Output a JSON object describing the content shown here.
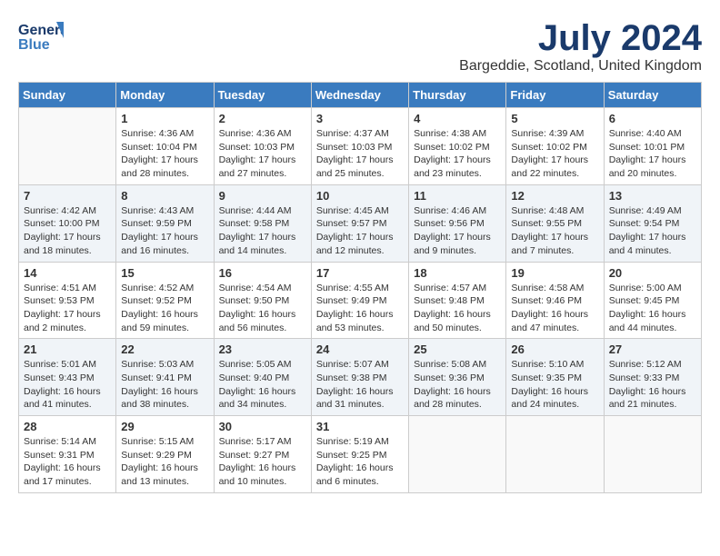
{
  "logo": {
    "line1": "General",
    "line2": "Blue"
  },
  "title": "July 2024",
  "location": "Bargeddie, Scotland, United Kingdom",
  "days_header": [
    "Sunday",
    "Monday",
    "Tuesday",
    "Wednesday",
    "Thursday",
    "Friday",
    "Saturday"
  ],
  "weeks": [
    [
      {
        "day": "",
        "info": ""
      },
      {
        "day": "1",
        "info": "Sunrise: 4:36 AM\nSunset: 10:04 PM\nDaylight: 17 hours\nand 28 minutes."
      },
      {
        "day": "2",
        "info": "Sunrise: 4:36 AM\nSunset: 10:03 PM\nDaylight: 17 hours\nand 27 minutes."
      },
      {
        "day": "3",
        "info": "Sunrise: 4:37 AM\nSunset: 10:03 PM\nDaylight: 17 hours\nand 25 minutes."
      },
      {
        "day": "4",
        "info": "Sunrise: 4:38 AM\nSunset: 10:02 PM\nDaylight: 17 hours\nand 23 minutes."
      },
      {
        "day": "5",
        "info": "Sunrise: 4:39 AM\nSunset: 10:02 PM\nDaylight: 17 hours\nand 22 minutes."
      },
      {
        "day": "6",
        "info": "Sunrise: 4:40 AM\nSunset: 10:01 PM\nDaylight: 17 hours\nand 20 minutes."
      }
    ],
    [
      {
        "day": "7",
        "info": "Sunrise: 4:42 AM\nSunset: 10:00 PM\nDaylight: 17 hours\nand 18 minutes."
      },
      {
        "day": "8",
        "info": "Sunrise: 4:43 AM\nSunset: 9:59 PM\nDaylight: 17 hours\nand 16 minutes."
      },
      {
        "day": "9",
        "info": "Sunrise: 4:44 AM\nSunset: 9:58 PM\nDaylight: 17 hours\nand 14 minutes."
      },
      {
        "day": "10",
        "info": "Sunrise: 4:45 AM\nSunset: 9:57 PM\nDaylight: 17 hours\nand 12 minutes."
      },
      {
        "day": "11",
        "info": "Sunrise: 4:46 AM\nSunset: 9:56 PM\nDaylight: 17 hours\nand 9 minutes."
      },
      {
        "day": "12",
        "info": "Sunrise: 4:48 AM\nSunset: 9:55 PM\nDaylight: 17 hours\nand 7 minutes."
      },
      {
        "day": "13",
        "info": "Sunrise: 4:49 AM\nSunset: 9:54 PM\nDaylight: 17 hours\nand 4 minutes."
      }
    ],
    [
      {
        "day": "14",
        "info": "Sunrise: 4:51 AM\nSunset: 9:53 PM\nDaylight: 17 hours\nand 2 minutes."
      },
      {
        "day": "15",
        "info": "Sunrise: 4:52 AM\nSunset: 9:52 PM\nDaylight: 16 hours\nand 59 minutes."
      },
      {
        "day": "16",
        "info": "Sunrise: 4:54 AM\nSunset: 9:50 PM\nDaylight: 16 hours\nand 56 minutes."
      },
      {
        "day": "17",
        "info": "Sunrise: 4:55 AM\nSunset: 9:49 PM\nDaylight: 16 hours\nand 53 minutes."
      },
      {
        "day": "18",
        "info": "Sunrise: 4:57 AM\nSunset: 9:48 PM\nDaylight: 16 hours\nand 50 minutes."
      },
      {
        "day": "19",
        "info": "Sunrise: 4:58 AM\nSunset: 9:46 PM\nDaylight: 16 hours\nand 47 minutes."
      },
      {
        "day": "20",
        "info": "Sunrise: 5:00 AM\nSunset: 9:45 PM\nDaylight: 16 hours\nand 44 minutes."
      }
    ],
    [
      {
        "day": "21",
        "info": "Sunrise: 5:01 AM\nSunset: 9:43 PM\nDaylight: 16 hours\nand 41 minutes."
      },
      {
        "day": "22",
        "info": "Sunrise: 5:03 AM\nSunset: 9:41 PM\nDaylight: 16 hours\nand 38 minutes."
      },
      {
        "day": "23",
        "info": "Sunrise: 5:05 AM\nSunset: 9:40 PM\nDaylight: 16 hours\nand 34 minutes."
      },
      {
        "day": "24",
        "info": "Sunrise: 5:07 AM\nSunset: 9:38 PM\nDaylight: 16 hours\nand 31 minutes."
      },
      {
        "day": "25",
        "info": "Sunrise: 5:08 AM\nSunset: 9:36 PM\nDaylight: 16 hours\nand 28 minutes."
      },
      {
        "day": "26",
        "info": "Sunrise: 5:10 AM\nSunset: 9:35 PM\nDaylight: 16 hours\nand 24 minutes."
      },
      {
        "day": "27",
        "info": "Sunrise: 5:12 AM\nSunset: 9:33 PM\nDaylight: 16 hours\nand 21 minutes."
      }
    ],
    [
      {
        "day": "28",
        "info": "Sunrise: 5:14 AM\nSunset: 9:31 PM\nDaylight: 16 hours\nand 17 minutes."
      },
      {
        "day": "29",
        "info": "Sunrise: 5:15 AM\nSunset: 9:29 PM\nDaylight: 16 hours\nand 13 minutes."
      },
      {
        "day": "30",
        "info": "Sunrise: 5:17 AM\nSunset: 9:27 PM\nDaylight: 16 hours\nand 10 minutes."
      },
      {
        "day": "31",
        "info": "Sunrise: 5:19 AM\nSunset: 9:25 PM\nDaylight: 16 hours\nand 6 minutes."
      },
      {
        "day": "",
        "info": ""
      },
      {
        "day": "",
        "info": ""
      },
      {
        "day": "",
        "info": ""
      }
    ]
  ]
}
